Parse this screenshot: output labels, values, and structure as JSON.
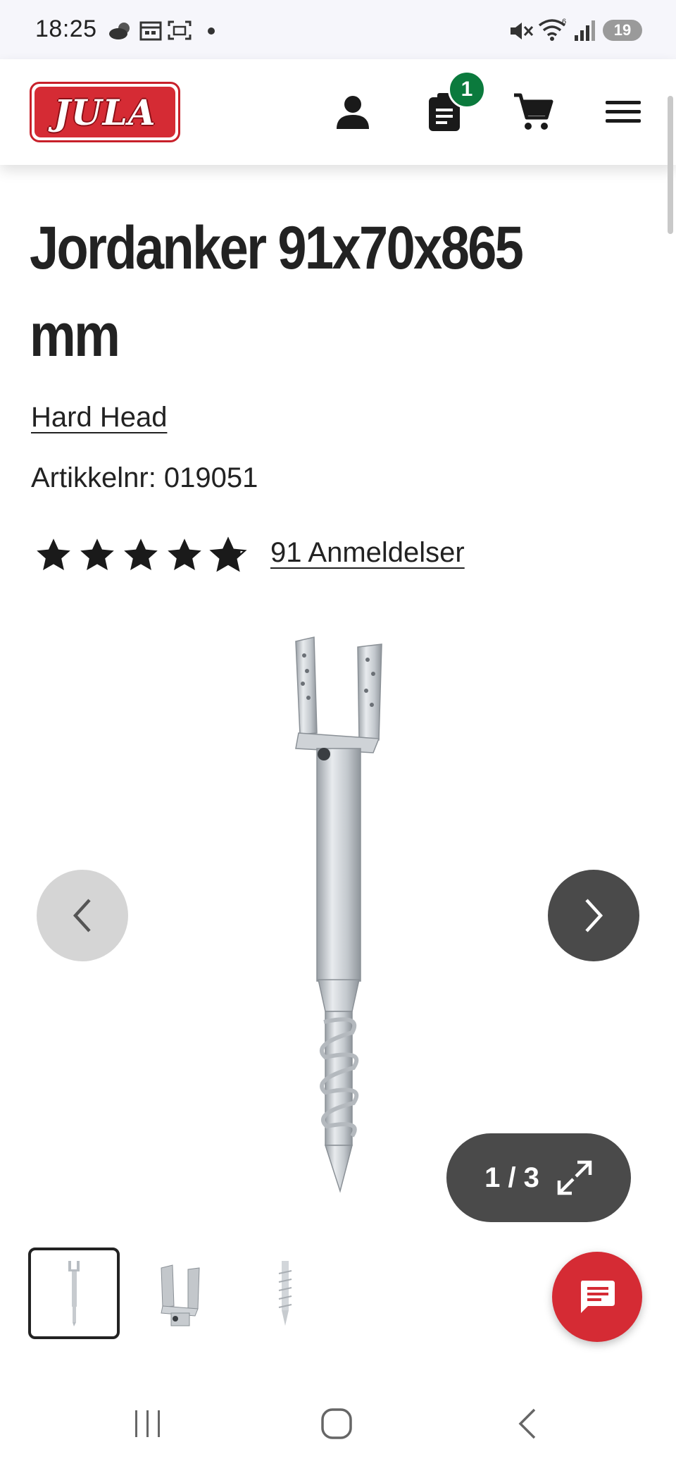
{
  "status_bar": {
    "time": "18:25",
    "battery": "19",
    "icons": [
      "weather-icon",
      "calendar-icon",
      "screenshot-icon",
      "dot-icon",
      "mute-icon",
      "wifi-icon",
      "signal-icon",
      "battery-icon"
    ]
  },
  "header": {
    "logo_text": "JULA",
    "cart_badge_count": "1",
    "icons": [
      "account-icon",
      "clipboard-list-icon",
      "cart-icon",
      "menu-icon"
    ],
    "brand_color": "#d52b34",
    "badge_color": "#0b7a3d"
  },
  "product": {
    "title": "Jordanker 91x70x865 mm",
    "brand": "Hard Head",
    "article_number": "Artikkelnr: 019051",
    "rating": 4.8,
    "rating_max": 5,
    "reviews_label": "91 Anmeldelser"
  },
  "gallery": {
    "counter": "1 / 3",
    "current": 1,
    "total": 3,
    "icons": [
      "chevron-left-icon",
      "chevron-right-icon",
      "expand-icon"
    ]
  },
  "chat": {
    "icon": "chat-icon"
  },
  "system_nav": {
    "icons": [
      "recents-icon",
      "home-icon",
      "back-icon"
    ]
  }
}
